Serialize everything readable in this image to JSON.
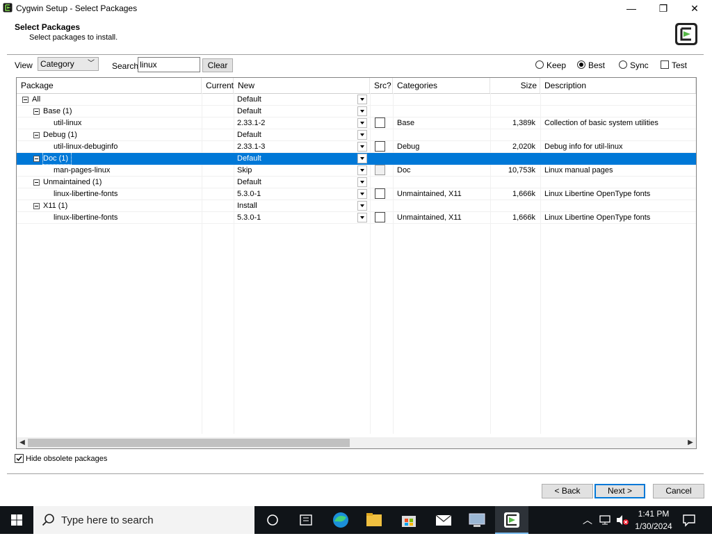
{
  "window": {
    "title": "Cygwin Setup - Select Packages",
    "controls": {
      "minimize": "—",
      "maximize": "❐",
      "close": "✕"
    }
  },
  "header": {
    "title": "Select Packages",
    "subtitle": "Select packages to install."
  },
  "toolbar": {
    "view_label": "View",
    "view_value": "Category",
    "search_label": "Search",
    "search_value": "linux",
    "clear_label": "Clear",
    "radios": [
      {
        "label": "Keep",
        "checked": false
      },
      {
        "label": "Best",
        "checked": true
      },
      {
        "label": "Sync",
        "checked": false
      }
    ],
    "test_label": "Test",
    "test_checked": false
  },
  "columns": [
    "Package",
    "Current",
    "New",
    "Src?",
    "Categories",
    "Size",
    "Description"
  ],
  "rows": [
    {
      "package": "All",
      "current": "",
      "new": "Default",
      "categories": "",
      "size": "",
      "description": "",
      "level": 0,
      "has_src": false,
      "selected": false
    },
    {
      "package": "Base (1)",
      "current": "",
      "new": "Default",
      "categories": "",
      "size": "",
      "description": "",
      "level": 1,
      "has_src": false,
      "selected": false
    },
    {
      "package": "util-linux",
      "current": "",
      "new": "2.33.1-2",
      "categories": "Base",
      "size": "1,389k",
      "description": "Collection of basic system utilities",
      "level": 2,
      "has_src": true,
      "selected": false
    },
    {
      "package": "Debug (1)",
      "current": "",
      "new": "Default",
      "categories": "",
      "size": "",
      "description": "",
      "level": 1,
      "has_src": false,
      "selected": false
    },
    {
      "package": "util-linux-debuginfo",
      "current": "",
      "new": "2.33.1-3",
      "categories": "Debug",
      "size": "2,020k",
      "description": "Debug info for util-linux",
      "level": 2,
      "has_src": true,
      "selected": false
    },
    {
      "package": "Doc (1)",
      "current": "",
      "new": "Default",
      "categories": "",
      "size": "",
      "description": "",
      "level": 1,
      "has_src": false,
      "selected": true
    },
    {
      "package": "man-pages-linux",
      "current": "",
      "new": "Skip",
      "categories": "Doc",
      "size": "10,753k",
      "description": "Linux manual pages",
      "level": 2,
      "has_src": true,
      "selected": false,
      "src_dim": true
    },
    {
      "package": "Unmaintained (1)",
      "current": "",
      "new": "Default",
      "categories": "",
      "size": "",
      "description": "",
      "level": 1,
      "has_src": false,
      "selected": false
    },
    {
      "package": "linux-libertine-fonts",
      "current": "",
      "new": "5.3.0-1",
      "categories": "Unmaintained, X11",
      "size": "1,666k",
      "description": "Linux Libertine OpenType fonts",
      "level": 2,
      "has_src": true,
      "selected": false
    },
    {
      "package": "X11 (1)",
      "current": "",
      "new": "Install",
      "categories": "",
      "size": "",
      "description": "",
      "level": 1,
      "has_src": false,
      "selected": false
    },
    {
      "package": "linux-libertine-fonts",
      "current": "",
      "new": "5.3.0-1",
      "categories": "Unmaintained, X11",
      "size": "1,666k",
      "description": "Linux Libertine OpenType fonts",
      "level": 2,
      "has_src": true,
      "selected": false
    }
  ],
  "footer": {
    "hide_obsolete_label": "Hide obsolete packages",
    "hide_obsolete_checked": true,
    "back_label": "< Back",
    "next_label": "Next >",
    "cancel_label": "Cancel"
  },
  "taskbar": {
    "search_placeholder": "Type here to search",
    "time": "1:41 PM",
    "date": "1/30/2024"
  },
  "colors": {
    "selection": "#0078d7",
    "taskbar": "#101418"
  }
}
